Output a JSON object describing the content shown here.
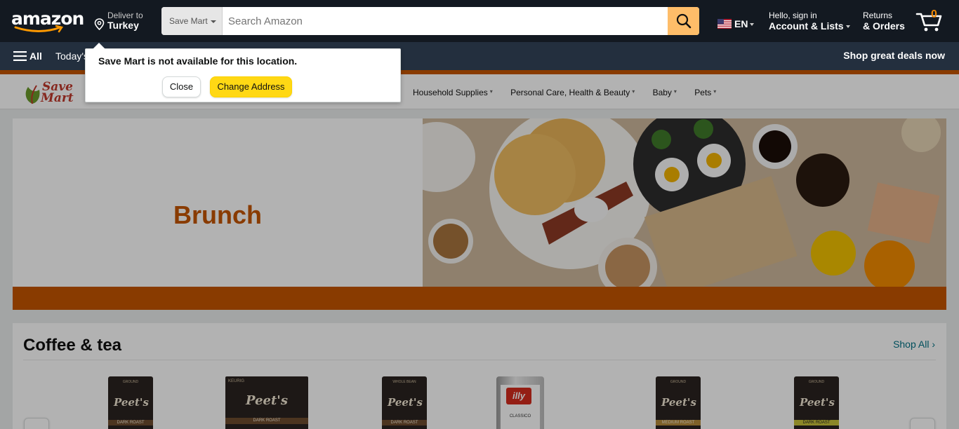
{
  "header": {
    "logo_text": "amazon",
    "deliver_line1": "Deliver to",
    "deliver_line2": "Turkey",
    "search": {
      "category": "Save Mart",
      "placeholder": "Search Amazon",
      "value": ""
    },
    "language": "EN",
    "account_line1": "Hello, sign in",
    "account_line2": "Account & Lists",
    "returns_line1": "Returns",
    "returns_line2": "& Orders",
    "cart_count": "0",
    "icons": [
      "location-pin-icon",
      "search-icon",
      "us-flag-icon",
      "cart-icon"
    ]
  },
  "nav": {
    "all_label": "All",
    "today_label": "Today's",
    "promo": "Shop great deals now"
  },
  "store_nav": {
    "logo_line1": "Save",
    "logo_line2": "Mart",
    "links": [
      {
        "label": "Household Supplies"
      },
      {
        "label": "Personal Care, Health & Beauty"
      },
      {
        "label": "Baby"
      },
      {
        "label": "Pets"
      }
    ]
  },
  "banner": {
    "title": "Brunch"
  },
  "section": {
    "title": "Coffee & tea",
    "shop_all": "Shop All",
    "products": [
      {
        "kind": "bag",
        "brand": "Peet's",
        "top": "GROUND",
        "band": "DARK ROAST"
      },
      {
        "kind": "box",
        "brand": "Peet's",
        "top": "KEURIG",
        "band": "DARK ROAST"
      },
      {
        "kind": "bag",
        "brand": "Peet's",
        "top": "WHOLE BEAN",
        "band": "DARK ROAST"
      },
      {
        "kind": "tin",
        "brand": "illy",
        "top": "",
        "band": "CLASSICO"
      },
      {
        "kind": "bag",
        "brand": "Peet's",
        "top": "GROUND",
        "band": "MEDIUM ROAST"
      },
      {
        "kind": "bag",
        "brand": "Peet's",
        "top": "GROUND",
        "band": "DARK ROAST"
      }
    ]
  },
  "popover": {
    "message": "Save Mart is not available for this location.",
    "close_label": "Close",
    "change_label": "Change Address"
  },
  "colors": {
    "header_bg": "#131921",
    "nav_bg": "#232f3e",
    "search_button": "#febd69",
    "accent_orange": "#c45500",
    "primary_button": "#ffd814",
    "link": "#007185"
  }
}
